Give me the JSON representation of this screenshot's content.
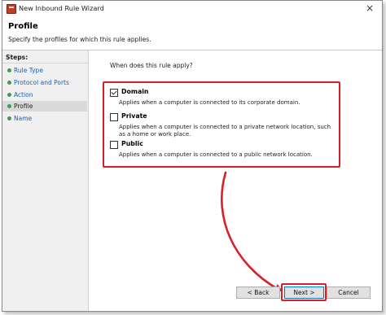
{
  "window": {
    "title": "New Inbound Rule Wizard",
    "close_glyph": "×"
  },
  "header": {
    "title": "Profile",
    "subtitle": "Specify the profiles for which this rule applies."
  },
  "sidebar": {
    "steps_label": "Steps:",
    "items": [
      {
        "label": "Rule Type",
        "active": false
      },
      {
        "label": "Protocol and Ports",
        "active": false
      },
      {
        "label": "Action",
        "active": false
      },
      {
        "label": "Profile",
        "active": true
      },
      {
        "label": "Name",
        "active": false
      }
    ]
  },
  "main": {
    "question": "When does this rule apply?",
    "options": [
      {
        "label": "Domain",
        "checked": true,
        "description": "Applies when a computer is connected to its corporate domain."
      },
      {
        "label": "Private",
        "checked": false,
        "description": "Applies when a computer is connected to a private network location, such as a home or work place."
      },
      {
        "label": "Public",
        "checked": false,
        "description": "Applies when a computer is connected to a public network location."
      }
    ]
  },
  "buttons": {
    "back": "< Back",
    "next": "Next >",
    "cancel": "Cancel"
  },
  "colors": {
    "annotation_red": "#d8202a",
    "link_blue": "#1a5fb4",
    "step_dot_green": "#3f9f3f"
  },
  "icons": {
    "title": "firewall-icon",
    "close": "close-icon",
    "step_bullet": "dot-icon",
    "annotation": "arrow-icon"
  }
}
